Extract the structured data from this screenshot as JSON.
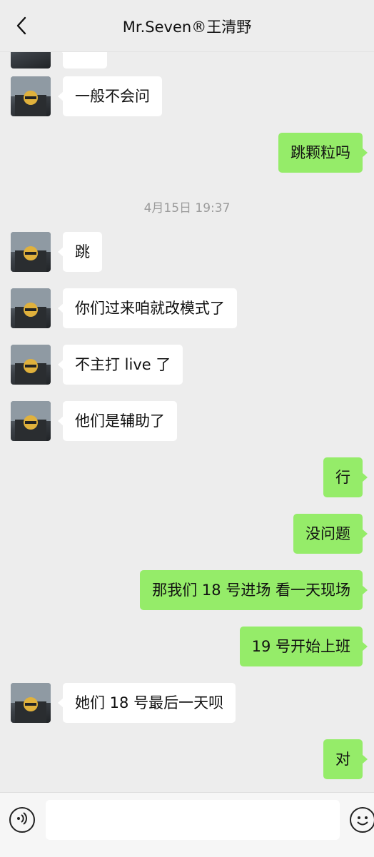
{
  "header": {
    "title": "Mr.Seven®王清野"
  },
  "timestamp": "4月15日 19:37",
  "messages": [
    {
      "side": "left",
      "text": "一般不会问"
    },
    {
      "side": "right",
      "text": "跳颗粒吗"
    },
    {
      "side": "left",
      "text": "跳"
    },
    {
      "side": "left",
      "text": "你们过来咱就改模式了"
    },
    {
      "side": "left",
      "text": "不主打 live 了"
    },
    {
      "side": "left",
      "text": "他们是辅助了"
    },
    {
      "side": "right",
      "text": "行"
    },
    {
      "side": "right",
      "text": "没问题"
    },
    {
      "side": "right",
      "text": "那我们 18 号进场 看一天现场"
    },
    {
      "side": "right",
      "text": "19 号开始上班"
    },
    {
      "side": "left",
      "text": "她们 18 号最后一天呗"
    },
    {
      "side": "right",
      "text": "对"
    }
  ],
  "colors": {
    "sent": "#95EC69",
    "received": "#FFFFFF",
    "background": "#EDEDED"
  },
  "icons": {
    "back": "chevron-left-icon",
    "voice": "voice-icon",
    "emoji": "emoji-icon"
  }
}
